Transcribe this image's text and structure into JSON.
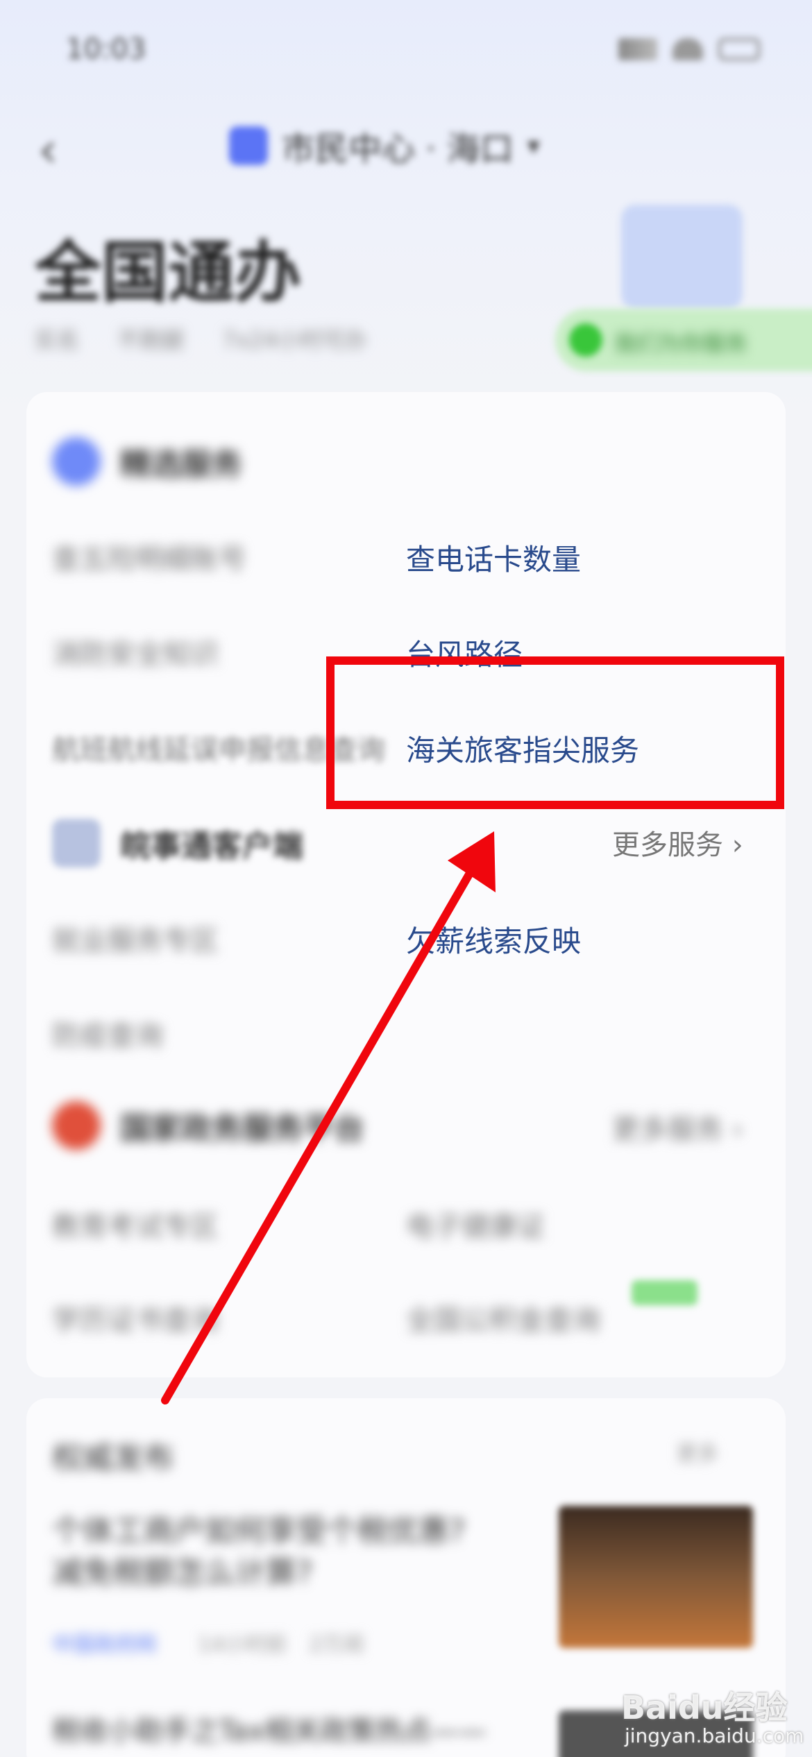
{
  "status_bar": {
    "time": "10:03"
  },
  "nav": {
    "city_label": "市民中心 · 海口"
  },
  "header": {
    "title": "全国通办",
    "tags": [
      "实名",
      "不跑腿",
      "7x24小时可办"
    ],
    "promo": "我们为你服务"
  },
  "section_selected": {
    "title": "精选服务",
    "left_items": [
      "查五险明细账号",
      "消防安全知识",
      "航班航线延误申报信息查询"
    ],
    "right_items": [
      "查电话卡数量",
      "台风路径",
      "海关旅客指尖服务"
    ]
  },
  "section_client": {
    "title": "皖事通客户端",
    "more": "更多服务",
    "left_items": [
      "就业服务专区",
      "防疫查询"
    ],
    "right_items": [
      "欠薪线索反映"
    ]
  },
  "section_national": {
    "title": "国家政务服务平台",
    "more": "更多服务",
    "left_items": [
      "教育考试专区",
      "学历证书查询"
    ],
    "right_items": [
      "电子健康证",
      "全国公积金查询"
    ]
  },
  "news": {
    "title": "权威发布",
    "more": "更多",
    "article1_line1": "个体工商户如何享受个税优惠?",
    "article1_line2": "减免税额怎么计算?",
    "article1_source": "中国政府网",
    "article1_time": "14小时前",
    "article1_reads": "2万阅",
    "article2_line1": "税收小助手之Tax相关政策热点——"
  },
  "annotation": {
    "box_color": "#f0060d"
  },
  "watermark": {
    "brand": "Baidu经验",
    "site": "jingyan.baidu.com"
  }
}
